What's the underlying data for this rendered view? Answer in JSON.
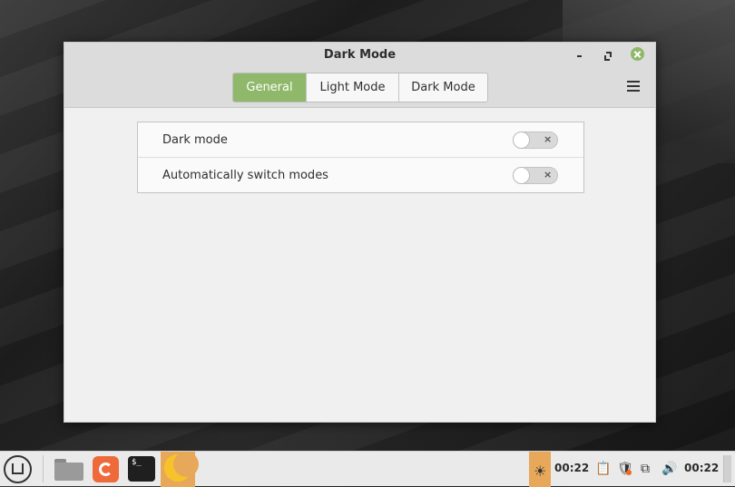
{
  "window": {
    "title": "Dark Mode",
    "tabs": [
      {
        "label": "General",
        "active": true
      },
      {
        "label": "Light Mode",
        "active": false
      },
      {
        "label": "Dark Mode",
        "active": false
      }
    ]
  },
  "settings": [
    {
      "label": "Dark mode",
      "enabled": false,
      "toggle_mark": "×"
    },
    {
      "label": "Automatically switch modes",
      "enabled": false,
      "toggle_mark": "×"
    }
  ],
  "taskbar": {
    "terminal_glyph": "$_",
    "tray_time_1": "00:22",
    "tray_time_2": "00:22",
    "icons": [
      "mint-menu-icon",
      "files-icon",
      "firefox-icon",
      "terminal-icon",
      "dark-mode-moon-icon",
      "sun-icon",
      "clipboard-icon",
      "shield-icon",
      "network-icon",
      "volume-icon"
    ]
  },
  "colors": {
    "accent": "#8fb86a",
    "panel_highlight": "#e8a85a",
    "moon": "#f6c42a"
  }
}
